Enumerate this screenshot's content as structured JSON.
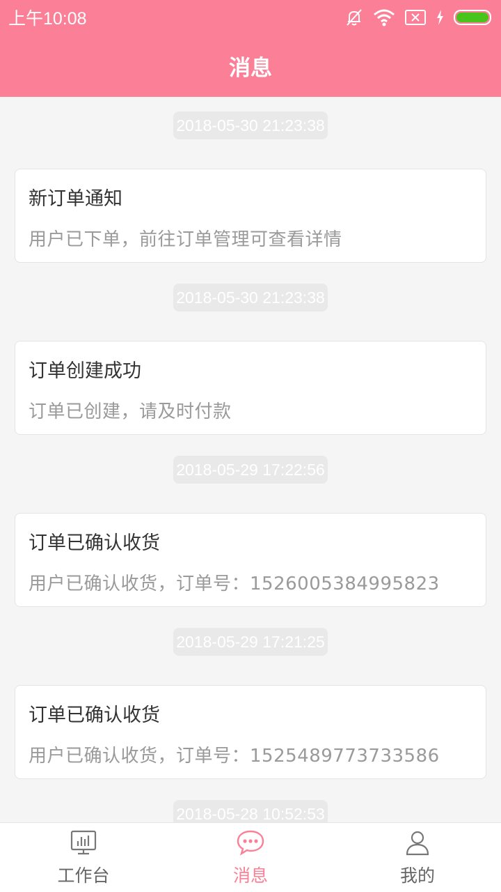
{
  "status_bar": {
    "time": "上午10:08",
    "icons": [
      "bell-off-icon",
      "wifi-icon",
      "sim-off-icon",
      "charging-icon",
      "battery-icon"
    ],
    "battery_color": "#49c41d"
  },
  "header": {
    "title": "消息",
    "background": "#fb7f96"
  },
  "messages": [
    {
      "time": "2018-05-30 21:23:38",
      "title": "新订单通知",
      "body": "用户已下单，前往订单管理可查看详情"
    },
    {
      "time": "2018-05-30 21:23:38",
      "title": "订单创建成功",
      "body": "订单已创建，请及时付款"
    },
    {
      "time": "2018-05-29 17:22:56",
      "title": "订单已确认收货",
      "body": "用户已确认收货，订单号：1526005384995823"
    },
    {
      "time": "2018-05-29 17:21:25",
      "title": "订单已确认收货",
      "body": "用户已确认收货，订单号：1525489773733586"
    },
    {
      "time": "2018-05-28 10:52:53",
      "title": "",
      "body": ""
    }
  ],
  "tabs": [
    {
      "label": "工作台",
      "icon": "workbench-icon",
      "active": false
    },
    {
      "label": "消息",
      "icon": "message-icon",
      "active": true
    },
    {
      "label": "我的",
      "icon": "user-icon",
      "active": false
    }
  ],
  "colors": {
    "accent": "#fb7f96",
    "inactive": "#666666"
  }
}
